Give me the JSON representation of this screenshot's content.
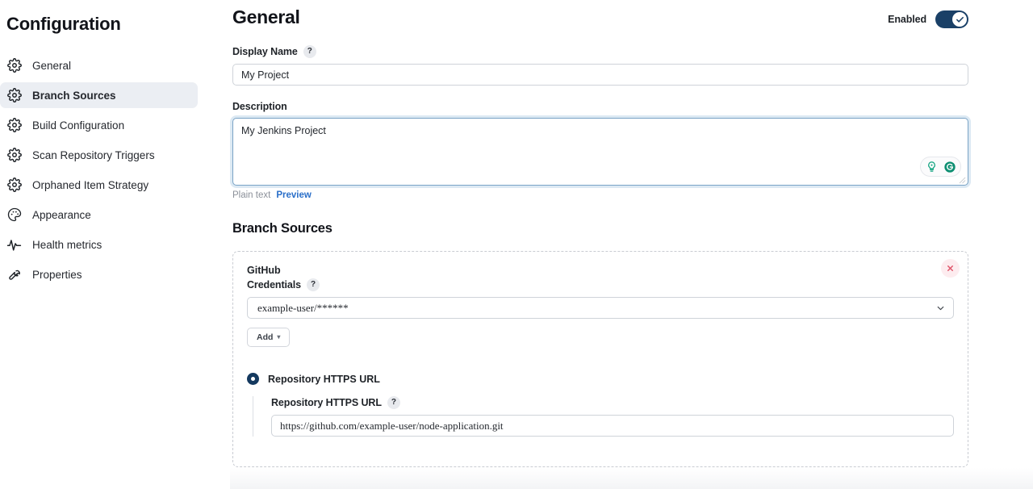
{
  "sidebar": {
    "title": "Configuration",
    "items": [
      {
        "label": "General",
        "icon": "gear-icon",
        "active": false
      },
      {
        "label": "Branch Sources",
        "icon": "gear-icon",
        "active": true
      },
      {
        "label": "Build Configuration",
        "icon": "gear-icon",
        "active": false
      },
      {
        "label": "Scan Repository Triggers",
        "icon": "gear-icon",
        "active": false
      },
      {
        "label": "Orphaned Item Strategy",
        "icon": "gear-icon",
        "active": false
      },
      {
        "label": "Appearance",
        "icon": "palette-icon",
        "active": false
      },
      {
        "label": "Health metrics",
        "icon": "pulse-icon",
        "active": false
      },
      {
        "label": "Properties",
        "icon": "wrench-icon",
        "active": false
      }
    ]
  },
  "header": {
    "title": "General",
    "enabled_label": "Enabled",
    "enabled_state": "on",
    "toggle_color": "#1a4067"
  },
  "general": {
    "display_name": {
      "label": "Display Name",
      "help": "?",
      "value": "My Project"
    },
    "description": {
      "label": "Description",
      "value": "My Jenkins Project",
      "markup_type": "Plain text",
      "preview_link": "Preview",
      "assistant_icons": [
        "lightbulb-icon",
        "codemie-g-icon"
      ],
      "accent_color": "#0e8f72"
    }
  },
  "branch_sources": {
    "heading": "Branch Sources",
    "source": {
      "title": "GitHub",
      "delete_label": "×",
      "delete_color": "#e0566b",
      "credentials": {
        "label": "Credentials",
        "help": "?",
        "selected": "example-user/******"
      },
      "add_button": {
        "label": "Add",
        "caret": "▾"
      },
      "repository": {
        "radio_label": "Repository HTTPS URL",
        "radio_selected": true,
        "field_label": "Repository HTTPS URL",
        "help": "?",
        "value": "https://github.com/example-user/node-application.git"
      }
    }
  }
}
